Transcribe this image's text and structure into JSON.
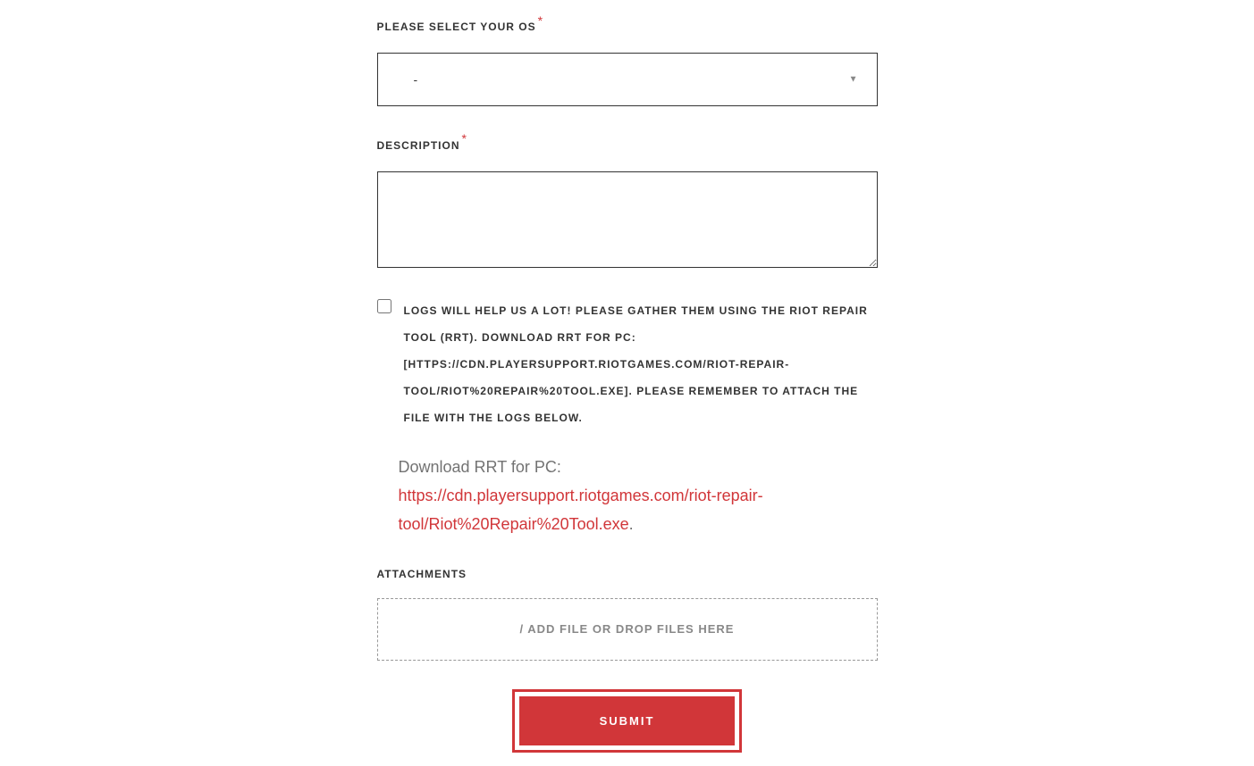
{
  "os_field": {
    "label": "PLEASE SELECT YOUR OS",
    "required_mark": "*",
    "selected_value": "-"
  },
  "description_field": {
    "label": "DESCRIPTION",
    "required_mark": "*",
    "value": ""
  },
  "logs_checkbox": {
    "label": "LOGS WILL HELP US A LOT! PLEASE GATHER THEM USING THE RIOT REPAIR TOOL (RRT). DOWNLOAD RRT FOR PC: [HTTPS://CDN.PLAYERSUPPORT.RIOTGAMES.COM/RIOT-REPAIR-TOOL/RIOT%20REPAIR%20TOOL.EXE]. PLEASE REMEMBER TO ATTACH THE FILE WITH THE LOGS BELOW."
  },
  "hint": {
    "prefix": "Download RRT for PC: ",
    "link_text": "https://cdn.playersupport.riotgames.com/riot-repair-tool/Riot%20Repair%20Tool.exe",
    "suffix": "."
  },
  "attachments": {
    "label": "ATTACHMENTS",
    "dropzone_text": "/ ADD FILE OR DROP FILES HERE"
  },
  "submit": {
    "label": "SUBMIT"
  }
}
